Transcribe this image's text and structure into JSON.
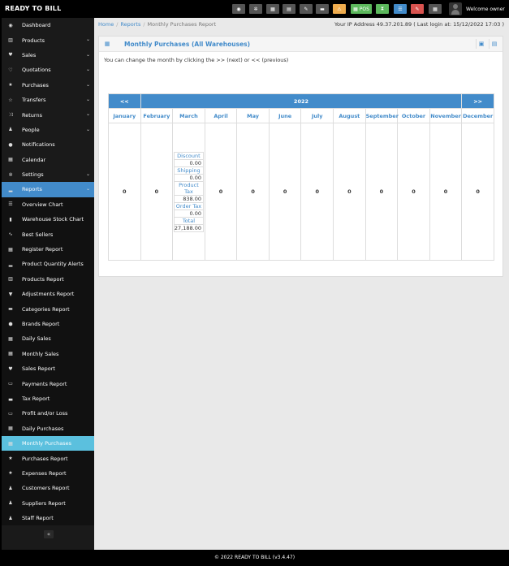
{
  "app": {
    "brand": "READY TO BILL",
    "welcome": "Welcome owner"
  },
  "toolbar": [
    {
      "icon": "dashboard-icon",
      "glyph": "◉",
      "label": "",
      "color": "#555555"
    },
    {
      "icon": "settings-icon",
      "glyph": "✲",
      "label": "",
      "color": "#555555"
    },
    {
      "icon": "calculator-icon",
      "glyph": "▦",
      "label": "",
      "color": "#555555"
    },
    {
      "icon": "calendar-icon",
      "glyph": "▤",
      "label": "",
      "color": "#555555"
    },
    {
      "icon": "tags-icon",
      "glyph": "✎",
      "label": "",
      "color": "#555555"
    },
    {
      "icon": "flag-icon",
      "glyph": "▬",
      "label": "",
      "color": "#555555"
    },
    {
      "icon": "alert-icon",
      "glyph": "⚠",
      "label": "",
      "color": "#f0ad4e"
    },
    {
      "icon": "pos-icon",
      "glyph": "▦",
      "label": "POS",
      "color": "#5cb85c"
    },
    {
      "icon": "hourglass-icon",
      "glyph": "⧗",
      "label": "",
      "color": "#5cb85c"
    },
    {
      "icon": "list-icon",
      "glyph": "☰",
      "label": "",
      "color": "#428bca"
    },
    {
      "icon": "pen-icon",
      "glyph": "✎",
      "label": "",
      "color": "#d9534f"
    },
    {
      "icon": "grid-icon",
      "glyph": "▦",
      "label": "",
      "color": "#555555"
    }
  ],
  "sidebar": [
    {
      "label": "Dashboard",
      "icon": "dashboard-icon",
      "glyph": "◉",
      "chevron": false,
      "state": "normal"
    },
    {
      "label": "Products",
      "icon": "barcode-icon",
      "glyph": "▥",
      "chevron": true,
      "state": "normal"
    },
    {
      "label": "Sales",
      "icon": "heart-icon",
      "glyph": "♥",
      "chevron": true,
      "state": "normal"
    },
    {
      "label": "Quotations",
      "icon": "heart-outline-icon",
      "glyph": "♡",
      "chevron": true,
      "state": "normal"
    },
    {
      "label": "Purchases",
      "icon": "star-icon",
      "glyph": "★",
      "chevron": true,
      "state": "normal"
    },
    {
      "label": "Transfers",
      "icon": "star-outline-icon",
      "glyph": "☆",
      "chevron": true,
      "state": "normal"
    },
    {
      "label": "Returns",
      "icon": "random-icon",
      "glyph": "⤨",
      "chevron": true,
      "state": "normal"
    },
    {
      "label": "People",
      "icon": "users-icon",
      "glyph": "♟",
      "chevron": true,
      "state": "normal"
    },
    {
      "label": "Notifications",
      "icon": "info-icon",
      "glyph": "●",
      "chevron": false,
      "state": "normal"
    },
    {
      "label": "Calendar",
      "icon": "calendar-icon",
      "glyph": "▦",
      "chevron": false,
      "state": "normal"
    },
    {
      "label": "Settings",
      "icon": "cog-icon",
      "glyph": "✲",
      "chevron": true,
      "state": "normal"
    },
    {
      "label": "Reports",
      "icon": "bar-chart-icon",
      "glyph": "▂",
      "chevron": true,
      "state": "active"
    },
    {
      "label": "Overview Chart",
      "icon": "list-icon",
      "glyph": "☰",
      "chevron": false,
      "state": "sub"
    },
    {
      "label": "Warehouse Stock Chart",
      "icon": "building-icon",
      "glyph": "▮",
      "chevron": false,
      "state": "sub"
    },
    {
      "label": "Best Sellers",
      "icon": "line-chart-icon",
      "glyph": "∿",
      "chevron": false,
      "state": "sub"
    },
    {
      "label": "Register Report",
      "icon": "th-large-icon",
      "glyph": "▦",
      "chevron": false,
      "state": "sub"
    },
    {
      "label": "Product Quantity Alerts",
      "icon": "bar-chart-icon",
      "glyph": "▂",
      "chevron": false,
      "state": "sub"
    },
    {
      "label": "Products Report",
      "icon": "barcode-icon",
      "glyph": "▥",
      "chevron": false,
      "state": "sub"
    },
    {
      "label": "Adjustments Report",
      "icon": "filter-icon",
      "glyph": "▼",
      "chevron": false,
      "state": "sub"
    },
    {
      "label": "Categories Report",
      "icon": "folder-icon",
      "glyph": "▬",
      "chevron": false,
      "state": "sub"
    },
    {
      "label": "Brands Report",
      "icon": "cubes-icon",
      "glyph": "⬢",
      "chevron": false,
      "state": "sub"
    },
    {
      "label": "Daily Sales",
      "icon": "calendar-icon",
      "glyph": "▦",
      "chevron": false,
      "state": "sub"
    },
    {
      "label": "Monthly Sales",
      "icon": "calendar-icon",
      "glyph": "▦",
      "chevron": false,
      "state": "sub"
    },
    {
      "label": "Sales Report",
      "icon": "heart-icon",
      "glyph": "♥",
      "chevron": false,
      "state": "sub"
    },
    {
      "label": "Payments Report",
      "icon": "money-icon",
      "glyph": "▭",
      "chevron": false,
      "state": "sub"
    },
    {
      "label": "Tax Report",
      "icon": "area-chart-icon",
      "glyph": "▃",
      "chevron": false,
      "state": "sub"
    },
    {
      "label": "Profit and/or Loss",
      "icon": "money-icon",
      "glyph": "▭",
      "chevron": false,
      "state": "sub"
    },
    {
      "label": "Daily Purchases",
      "icon": "calendar-icon",
      "glyph": "▦",
      "chevron": false,
      "state": "sub"
    },
    {
      "label": "Monthly Purchases",
      "icon": "calendar-icon",
      "glyph": "▦",
      "chevron": false,
      "state": "current"
    },
    {
      "label": "Purchases Report",
      "icon": "star-icon",
      "glyph": "★",
      "chevron": false,
      "state": "sub"
    },
    {
      "label": "Expenses Report",
      "icon": "star-icon",
      "glyph": "★",
      "chevron": false,
      "state": "sub"
    },
    {
      "label": "Customers Report",
      "icon": "users-icon",
      "glyph": "♟",
      "chevron": false,
      "state": "sub"
    },
    {
      "label": "Suppliers Report",
      "icon": "users-icon",
      "glyph": "♟",
      "chevron": false,
      "state": "sub"
    },
    {
      "label": "Staff Report",
      "icon": "users-icon",
      "glyph": "♟",
      "chevron": false,
      "state": "sub"
    }
  ],
  "sidebar_collapse_glyph": "«",
  "breadcrumb": {
    "home": "Home",
    "reports": "Reports",
    "current": "Monthly Purchases Report"
  },
  "ip_info": "Your IP Address 49.37.201.89 ( Last login at: 15/12/2022 17:03 )",
  "box": {
    "title": "Monthly Purchases (All Warehouses)",
    "intro": "You can change the month by clicking the >> (next) or << (previous)"
  },
  "calendar": {
    "prev": "<<",
    "next": ">>",
    "year": "2022",
    "months": [
      "January",
      "February",
      "March",
      "April",
      "May",
      "June",
      "July",
      "August",
      "September",
      "October",
      "November",
      "December"
    ],
    "values": [
      "0",
      "0",
      null,
      "0",
      "0",
      "0",
      "0",
      "0",
      "0",
      "0",
      "0",
      "0"
    ],
    "march": [
      {
        "label": "Discount",
        "value": "0.00"
      },
      {
        "label": "Shipping",
        "value": "0.00"
      },
      {
        "label": "Product Tax",
        "value": "838.00"
      },
      {
        "label": "Order Tax",
        "value": "0.00"
      },
      {
        "label": "Total",
        "value": "27,188.00"
      }
    ]
  },
  "footer": {
    "text": "© 2022 READY TO BILL (v3.4.47)"
  },
  "colors": {
    "primary": "#428bca",
    "current": "#5bc0de",
    "sidebar": "#1a1a1a"
  }
}
